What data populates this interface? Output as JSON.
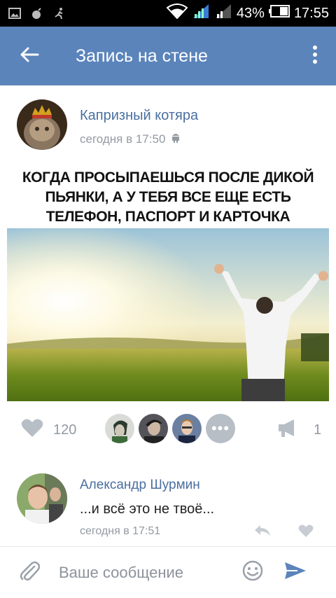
{
  "status_bar": {
    "battery": "43%",
    "time": "17:55",
    "icons": [
      "gallery-icon",
      "bomb-icon",
      "runner-icon",
      "wifi-icon",
      "signal-icon",
      "signal-2-icon",
      "battery-icon"
    ]
  },
  "app_bar": {
    "title": "Запись на стене",
    "back_icon": "arrow-left-icon",
    "menu_icon": "more-vertical-icon"
  },
  "post": {
    "author": "Капризный котяра",
    "time": "сегодня в 17:50",
    "platform_icon": "android-icon",
    "text": "КОГДА ПРОСЫПАЕШЬСЯ ПОСЛЕ ДИКОЙ ПЬЯНКИ, А У ТЕБЯ ВСЕ ЕЩЕ ЕСТЬ ТЕЛЕФОН, ПАСПОРТ И КАРТОЧКА",
    "likes": "120",
    "shares": "1",
    "more_likers": "•••"
  },
  "comment": {
    "author": "Александр Шурмин",
    "text": "...и всё это не твоё...",
    "time": "сегодня в 17:51"
  },
  "composer": {
    "placeholder": "Ваше сообщение"
  },
  "colors": {
    "app_bar": "#5b84bb",
    "link": "#4a6fa0",
    "muted": "#939aa3"
  }
}
